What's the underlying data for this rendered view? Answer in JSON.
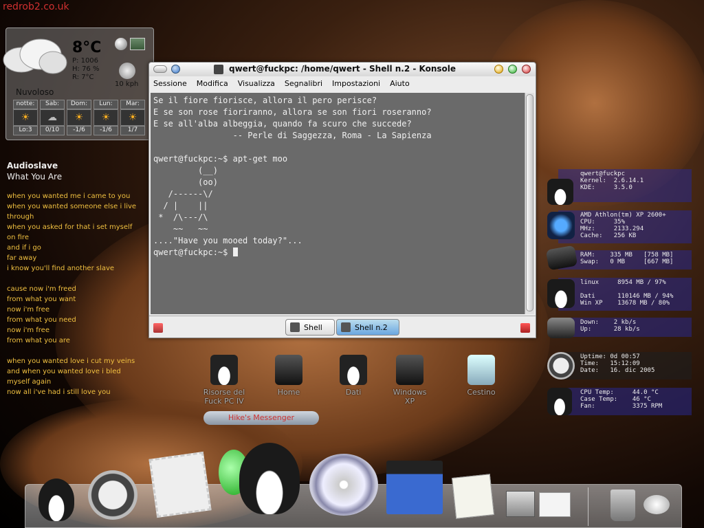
{
  "site": {
    "label": "redrob2.co.uk"
  },
  "weather": {
    "temperature": "8°C",
    "pressure": "P: 1006",
    "humidity": "H: 76 %",
    "realfeel": "R: 7°C",
    "wind": "10 kph",
    "condition": "Nuvoloso",
    "forecast": [
      {
        "day": "notte:",
        "range": "Lo:3",
        "icon": "sun-cloud-icon"
      },
      {
        "day": "Sab:",
        "range": "0/10",
        "icon": "cloud-icon"
      },
      {
        "day": "Dom:",
        "range": "-1/6",
        "icon": "sun-icon"
      },
      {
        "day": "Lun:",
        "range": "-1/6",
        "icon": "sun-cloud-icon"
      },
      {
        "day": "Mar:",
        "range": "1/7",
        "icon": "sun-cloud-icon"
      }
    ]
  },
  "lyrics": {
    "artist": "Audioslave",
    "song": "What You Are",
    "lines": [
      "when you wanted me i came to you",
      "when you wanted someone else i live",
      "through",
      "when you asked for that i set myself",
      "on fire",
      "and if i go",
      "far away",
      "i know you'll find another slave",
      "",
      "cause now i'm freed",
      "from what you want",
      "now i'm free",
      "from what you need",
      "now i'm free",
      "from what you are",
      "",
      "when you wanted love i cut my veins",
      "and when you wanted love i bled",
      "myself again",
      "now all i've had i still love you"
    ]
  },
  "konsole": {
    "title": "qwert@fuckpc: /home/qwert - Shell n.2 - Konsole",
    "menu": [
      "Sessione",
      "Modifica",
      "Visualizza",
      "Segnalibri",
      "Impostazioni",
      "Aiuto"
    ],
    "terminal_lines": [
      "Se il fiore fiorisce, allora il pero perisce?",
      "E se son rose fioriranno, allora se son fiori roseranno?",
      "E se all'alba albeggia, quando fa scuro che succede?",
      "                -- Perle di Saggezza, Roma - La Sapienza",
      "",
      "qwert@fuckpc:~$ apt-get moo",
      "         (__)",
      "         (oo)",
      "   /------\\/",
      "  / |    ||",
      " *  /\\---/\\",
      "    ~~   ~~",
      "....\"Have you mooed today?\"...",
      "qwert@fuckpc:~$ "
    ],
    "tabs": [
      "Shell",
      "Shell n.2"
    ]
  },
  "desktop_icons": [
    {
      "label": "Risorse del\nFuck PC IV"
    },
    {
      "label": "Home"
    },
    {
      "label": "Dati"
    },
    {
      "label": "Windows\nXP"
    },
    {
      "label": "Cestino"
    }
  ],
  "msn_button": {
    "label": "Hike's Messenger"
  },
  "sysmon": {
    "rows": [
      {
        "text": "qwert@fuckpc\nKernel:  2.6.14.1\nKDE:     3.5.0"
      },
      {
        "text": "AMD Athlon(tm) XP 2600+\nCPU:     35%\nMHz:     2133.294\nCache:   256 KB"
      },
      {
        "text": "RAM:    335 MB   [758 MB]\nSwap:   0 MB     [667 MB]"
      },
      {
        "text": "linux     8954 MB / 97%\n\nDati      110146 MB / 94%\nWin XP    13678 MB / 80%"
      },
      {
        "text": "Down:    2 kb/s\nUp:      28 kb/s"
      },
      {
        "text": "Uptime: 0d 00:57\nTime:   15:12:09\nDate:   16. dic 2005"
      },
      {
        "text": "CPU Temp:     44.0 °C\nCase Temp:    46 °C\nFan:          3375 RPM"
      }
    ]
  },
  "dock": {
    "items": [
      "finder-penguin-icon",
      "safari-compass-icon",
      "mail-stamp-icon",
      "messenger-icon",
      "konqueror-penguin-icon",
      "itunes-cd-icon",
      "video-clapper-icon",
      "textedit-doc-icon",
      "screenshot-icon",
      "sysprefs-icon",
      "trash-icon",
      "weather-clouds-icon"
    ]
  }
}
